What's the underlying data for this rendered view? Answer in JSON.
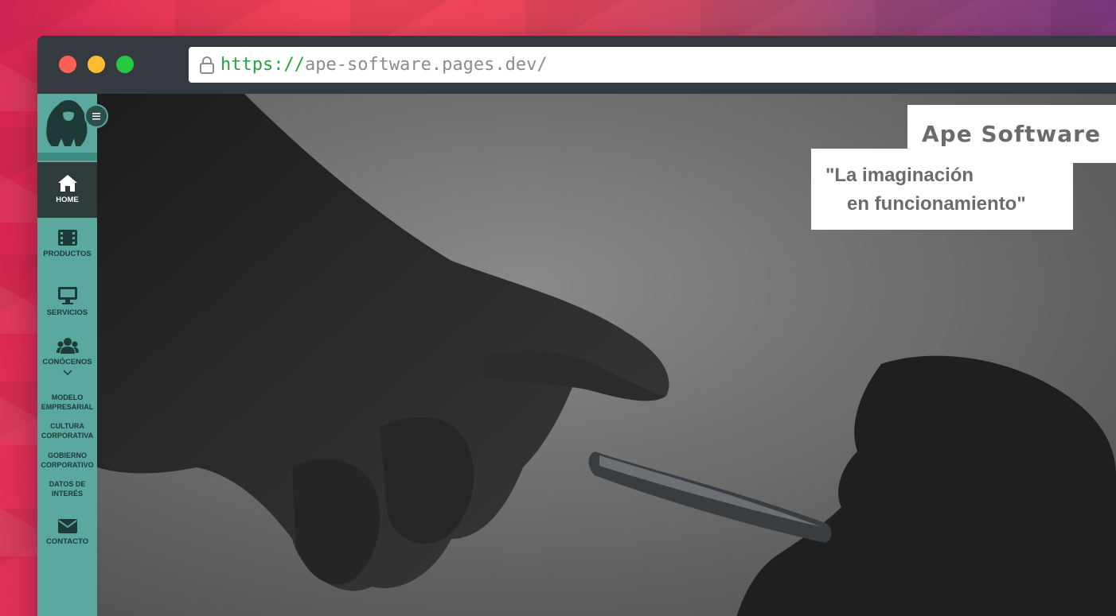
{
  "browser": {
    "url_scheme": "https://",
    "url_host": "ape-software.pages.dev/",
    "dots": [
      "close-dot",
      "minimize-dot",
      "maximize-dot"
    ]
  },
  "sidebar": {
    "logo_icon": "gorilla-logo-icon",
    "menu_toggle_icon": "menu-icon",
    "items": [
      {
        "label": "HOME",
        "icon": "home-icon",
        "active": true
      },
      {
        "label": "PRODUCTOS",
        "icon": "film-icon",
        "active": false
      },
      {
        "label": "SERVICIOS",
        "icon": "monitor-icon",
        "active": false
      },
      {
        "label": "CONÓCENOS",
        "icon": "users-icon",
        "active": false
      },
      {
        "label": "CONTACTO",
        "icon": "envelope-icon",
        "active": false
      }
    ],
    "submenu": [
      {
        "line1": "MODELO",
        "line2": "EMPRESARIAL"
      },
      {
        "line1": "CULTURA",
        "line2": "CORPORATIVA"
      },
      {
        "line1": "GOBIERNO",
        "line2": "CORPORATIVO"
      },
      {
        "line1": "DATOS DE",
        "line2": "INTERÉS"
      }
    ]
  },
  "hero": {
    "brand": "Ape Software",
    "tagline_line1": "\"La imaginación",
    "tagline_line2": "en funcionamiento\""
  },
  "colors": {
    "sidebar": "#5ba8a0",
    "sidebar_active": "#2d3b3a",
    "url_scheme": "#2aa140",
    "brand_text": "#6b6b6b"
  }
}
